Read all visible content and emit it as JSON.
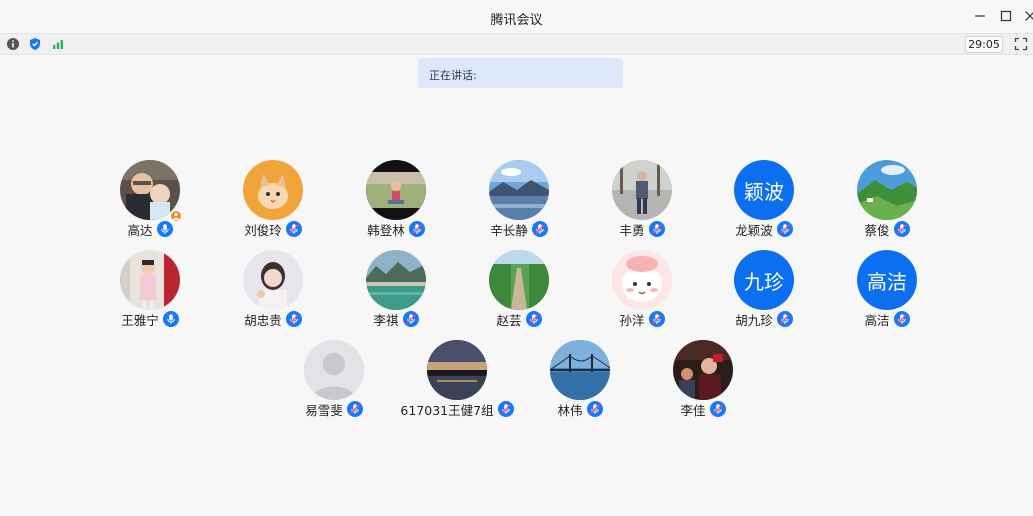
{
  "window": {
    "title": "腾讯会议",
    "controls": [
      "minimize-icon",
      "maximize-icon",
      "close-icon"
    ]
  },
  "toolbar": {
    "icons": [
      "info-icon",
      "shield-icon",
      "signal-icon",
      "fullscreen-icon"
    ],
    "timer": "29:05"
  },
  "speaking": {
    "label": "正在讲话:"
  },
  "participants": [
    {
      "name": "高达",
      "mic": "on",
      "host": true,
      "avatar": "photo"
    },
    {
      "name": "刘俊玲",
      "mic": "off",
      "avatar": "photo"
    },
    {
      "name": "韩登林",
      "mic": "off",
      "avatar": "photo"
    },
    {
      "name": "辛长静",
      "mic": "off",
      "avatar": "photo"
    },
    {
      "name": "丰勇",
      "mic": "off",
      "avatar": "photo"
    },
    {
      "name": "龙颖波",
      "mic": "off",
      "avatar": "text",
      "avatar_text": "颖波"
    },
    {
      "name": "蔡俊",
      "mic": "off",
      "avatar": "photo"
    },
    {
      "name": "王雅宁",
      "mic": "on",
      "avatar": "photo"
    },
    {
      "name": "胡忠贵",
      "mic": "off",
      "avatar": "photo"
    },
    {
      "name": "李祺",
      "mic": "off",
      "avatar": "photo"
    },
    {
      "name": "赵芸",
      "mic": "off",
      "avatar": "photo"
    },
    {
      "name": "孙洋",
      "mic": "off",
      "avatar": "photo"
    },
    {
      "name": "胡九珍",
      "mic": "off",
      "avatar": "text",
      "avatar_text": "九珍"
    },
    {
      "name": "高洁",
      "mic": "off",
      "avatar": "text",
      "avatar_text": "高洁"
    },
    {
      "name": "易雪斐",
      "mic": "off",
      "avatar": "default"
    },
    {
      "name": "617031王健7组",
      "mic": "off",
      "avatar": "photo"
    },
    {
      "name": "林伟",
      "mic": "off",
      "avatar": "photo"
    },
    {
      "name": "李佳",
      "mic": "off",
      "avatar": "photo"
    }
  ],
  "colors": {
    "accent": "#0c6ff0",
    "mic_icon": "#1677ff",
    "host_badge": "#f08a24",
    "speaking_bg": "#dde9fb"
  }
}
